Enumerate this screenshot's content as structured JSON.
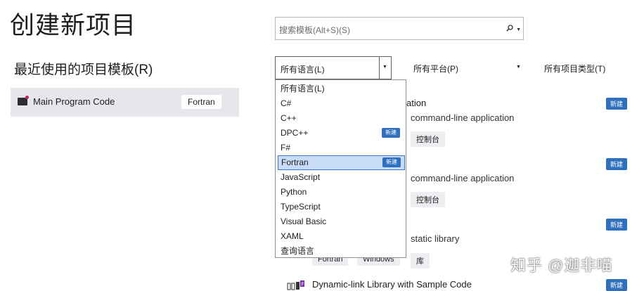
{
  "title": "创建新项目",
  "recent": {
    "header": "最近使用的项目模板(R)",
    "items": [
      {
        "name": "Main Program Code",
        "tag": "Fortran"
      }
    ]
  },
  "search": {
    "placeholder": "搜索模板(Alt+S)(S)"
  },
  "filters": {
    "language": "所有语言(L)",
    "platform": "所有平台(P)",
    "project_type": "所有项目类型(T)"
  },
  "language_options": [
    {
      "label": "所有语言(L)",
      "badge": ""
    },
    {
      "label": "C#",
      "badge": ""
    },
    {
      "label": "C++",
      "badge": ""
    },
    {
      "label": "DPC++",
      "badge": "新建"
    },
    {
      "label": "F#",
      "badge": ""
    },
    {
      "label": "Fortran",
      "badge": "新建",
      "selected": true
    },
    {
      "label": "JavaScript",
      "badge": ""
    },
    {
      "label": "Python",
      "badge": ""
    },
    {
      "label": "TypeScript",
      "badge": ""
    },
    {
      "label": "Visual Basic",
      "badge": ""
    },
    {
      "label": "XAML",
      "badge": ""
    },
    {
      "label": "查询语言",
      "badge": ""
    }
  ],
  "templates": [
    {
      "title_partial": "ation",
      "desc": "command-line application",
      "tags": [
        "控制台"
      ],
      "badge": "新建"
    },
    {
      "title_partial": "",
      "desc": "command-line application",
      "tags": [
        "控制台"
      ],
      "badge": "新建"
    },
    {
      "title_partial": "",
      "desc": "static library",
      "tags": [
        "Fortran",
        "Windows",
        "库"
      ],
      "badge": "新建"
    },
    {
      "title_partial": "Dynamic-link Library with Sample Code",
      "desc": "",
      "tags": [],
      "badge": "新建"
    }
  ],
  "watermark": "知乎 @迦非喵"
}
